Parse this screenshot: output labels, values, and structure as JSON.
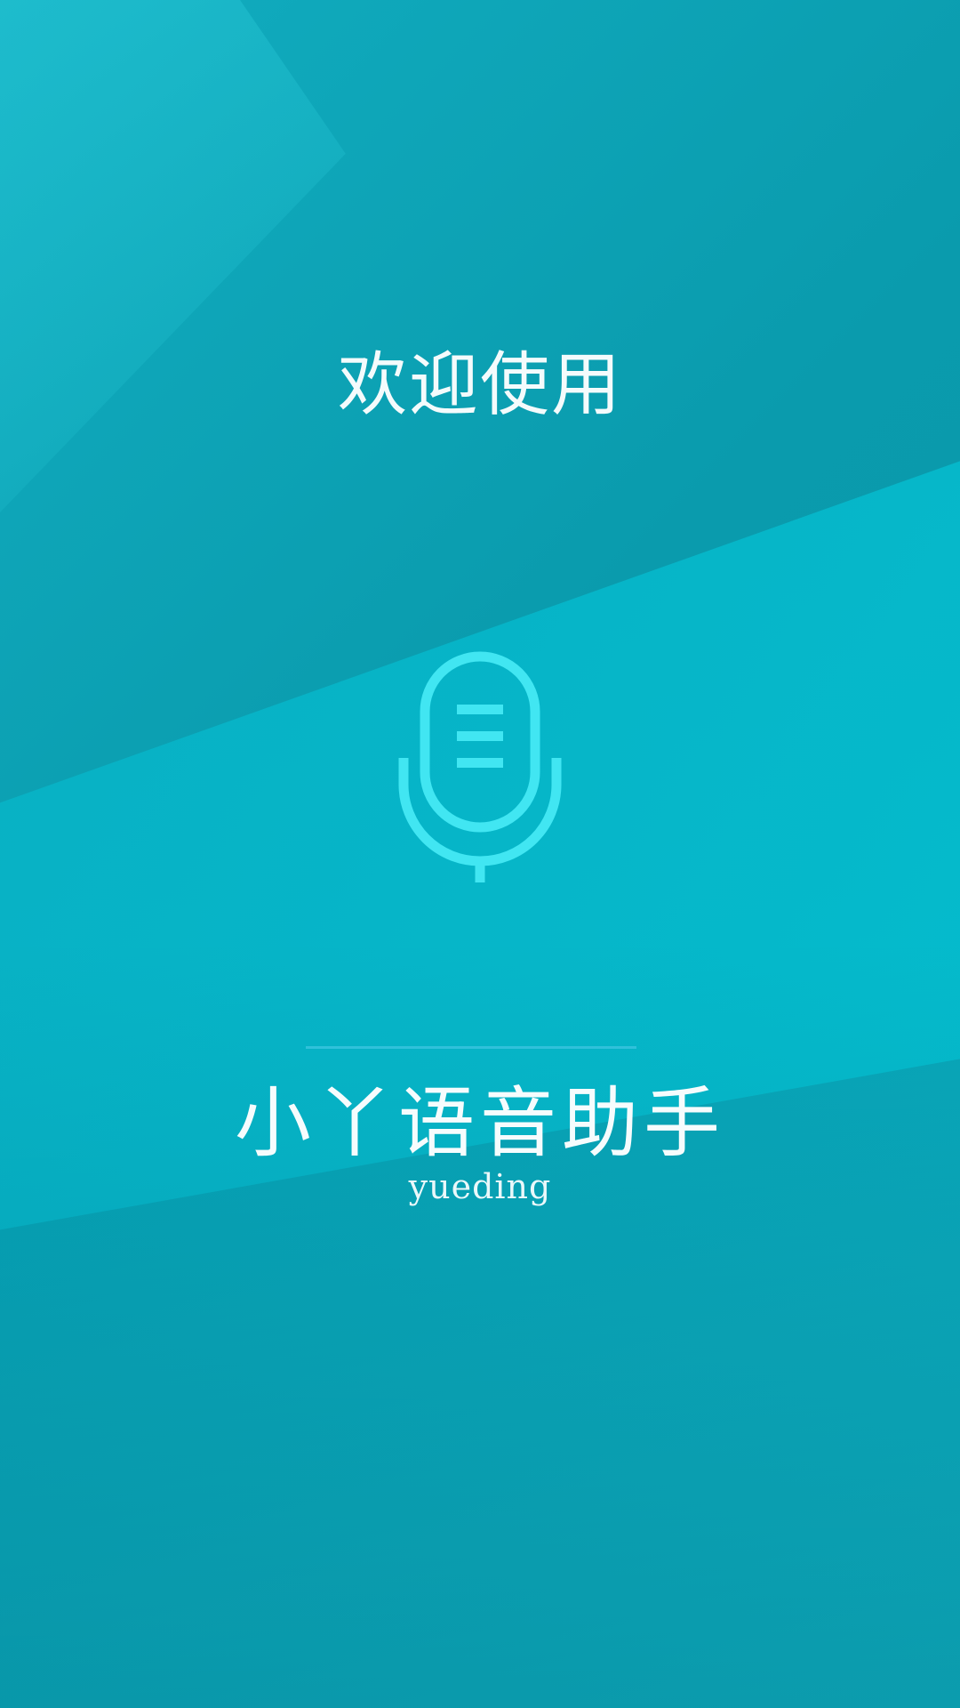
{
  "splash": {
    "welcome_text": "欢迎使用",
    "app_name": "小丫语音助手",
    "app_subtitle": "yueding",
    "icon": "microphone-icon"
  },
  "colors": {
    "background_dark": "#0897a9",
    "background_light": "#03c2d2",
    "icon_accent": "#41e6f2",
    "text": "#f4fbfc"
  }
}
